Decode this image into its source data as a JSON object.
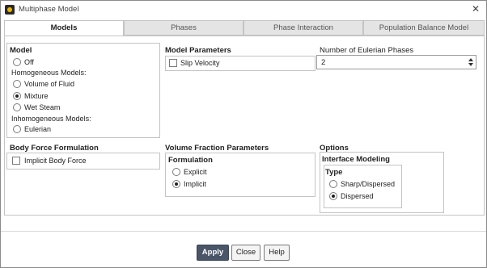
{
  "window": {
    "title": "Multiphase Model"
  },
  "tabs": [
    {
      "label": "Models"
    },
    {
      "label": "Phases"
    },
    {
      "label": "Phase Interaction"
    },
    {
      "label": "Population Balance Model"
    }
  ],
  "model": {
    "title": "Model",
    "off": "Off",
    "homogeneous_label": "Homogeneous Models:",
    "volume_of_fluid": "Volume of Fluid",
    "mixture": "Mixture",
    "wet_steam": "Wet Steam",
    "inhomogeneous_label": "Inhomogeneous Models:",
    "eulerian": "Eulerian",
    "selected": "Mixture"
  },
  "model_parameters": {
    "title": "Model Parameters",
    "slip_velocity": "Slip Velocity",
    "slip_velocity_checked": false
  },
  "eulerian_phases": {
    "title": "Number of Eulerian Phases",
    "value": "2"
  },
  "body_force": {
    "title": "Body Force Formulation",
    "implicit": "Implicit Body Force",
    "implicit_checked": false
  },
  "volume_fraction": {
    "title": "Volume Fraction Parameters",
    "formulation_title": "Formulation",
    "explicit": "Explicit",
    "implicit": "Implicit",
    "selected": "Implicit"
  },
  "options": {
    "title": "Options",
    "interface_title": "Interface Modeling",
    "type_title": "Type",
    "sharp_dispersed": "Sharp/Dispersed",
    "dispersed": "Dispersed",
    "selected": "Dispersed"
  },
  "footer": {
    "apply": "Apply",
    "close": "Close",
    "help": "Help"
  }
}
